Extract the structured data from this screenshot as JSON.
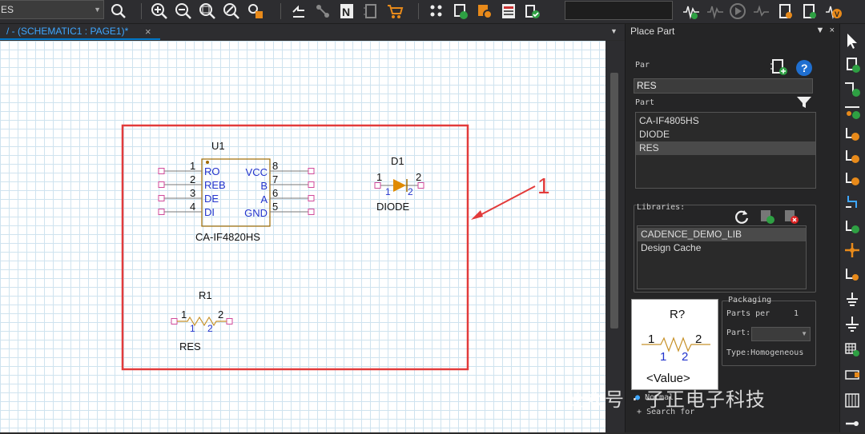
{
  "toolbar": {
    "part_combo_value": "ES",
    "tools": [
      "search-icon",
      "zoom-in-icon",
      "zoom-out-icon",
      "zoom-fit-icon",
      "zoom-area-icon",
      "properties-icon",
      "refresh-icon",
      "netlist-icon",
      "part-icon",
      "shopping-cart-icon",
      "grid-icon",
      "library-icon",
      "export-icon",
      "bom-icon",
      "check-icon",
      "wave-add-icon",
      "wave-icon",
      "play-icon",
      "probe-icon",
      "marker-icon",
      "voltage-marker-icon"
    ]
  },
  "document": {
    "tab_title": "/ - (SCHEMATIC1 : PAGE1)*"
  },
  "schematic": {
    "u1": {
      "refdes": "U1",
      "value": "CA-IF4820HS",
      "left_pins": [
        {
          "num": "1",
          "name": "RO"
        },
        {
          "num": "2",
          "name": "REB"
        },
        {
          "num": "3",
          "name": "DE"
        },
        {
          "num": "4",
          "name": "DI"
        }
      ],
      "right_pins": [
        {
          "num": "8",
          "name": "VCC"
        },
        {
          "num": "7",
          "name": "B"
        },
        {
          "num": "6",
          "name": "A"
        },
        {
          "num": "5",
          "name": "GND"
        }
      ]
    },
    "d1": {
      "refdes": "D1",
      "value": "DIODE",
      "pin1": "1",
      "pin2": "2",
      "pin_a": "1",
      "pin_b": "2"
    },
    "r1": {
      "refdes": "R1",
      "value": "RES",
      "pin1": "1",
      "pin2": "2",
      "pin_a": "1",
      "pin_b": "2"
    },
    "annotation": {
      "number": "1",
      "box_color": "#e23b3b"
    }
  },
  "place_part": {
    "title": "Place Part",
    "part_label": "Par",
    "part_value": "RES",
    "part_list_label": "Part",
    "parts": [
      "CA-IF4805HS",
      "DIODE",
      "RES"
    ],
    "selected_part": "RES",
    "libraries_label": "Libraries:",
    "libraries": [
      "CADENCE_DEMO_LIB",
      "Design Cache"
    ],
    "selected_library": "CADENCE_DEMO_LIB",
    "packaging": {
      "title": "Packaging",
      "parts_per_label": "Parts per",
      "parts_per_value": "1",
      "part_label": "Part:",
      "type_label": "Type:",
      "type_value": "Homogeneous"
    },
    "preview": {
      "refdes": "R?",
      "pin1": "1",
      "pin2": "2",
      "pin_a": "1",
      "pin_b": "2",
      "value": "<Value>"
    },
    "normal_label": "Normal",
    "search_label": "Search for"
  },
  "watermark": "公众号 · 子正电子科技",
  "colors": {
    "accent": "#007acc",
    "pin_text": "#2233cc",
    "component_body": "#a06a00",
    "annotation": "#e23b3b"
  }
}
